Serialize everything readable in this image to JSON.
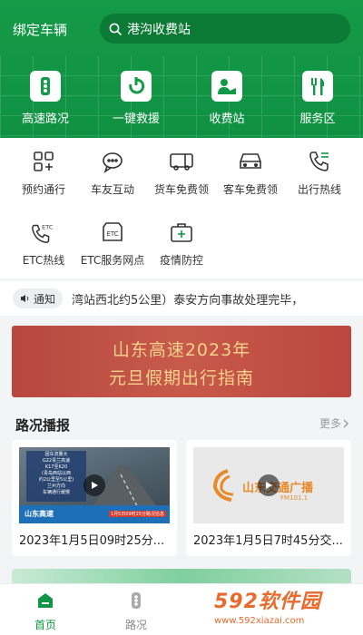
{
  "header": {
    "bind_car": "绑定车辆",
    "search_placeholder": "港沟收费站",
    "quick": [
      {
        "label": "高速路况",
        "icon": "traffic-light-icon"
      },
      {
        "label": "一键救援",
        "icon": "rescue-icon"
      },
      {
        "label": "收费站",
        "icon": "toll-station-icon"
      },
      {
        "label": "服务区",
        "icon": "service-area-icon"
      }
    ]
  },
  "services": [
    {
      "label": "预约通行",
      "icon": "reservation-grid-icon"
    },
    {
      "label": "车友互动",
      "icon": "chat-bubble-icon"
    },
    {
      "label": "货车免费领",
      "icon": "truck-icon"
    },
    {
      "label": "客车免费领",
      "icon": "car-icon"
    },
    {
      "label": "出行热线",
      "icon": "phone-icon"
    },
    {
      "label": "ETC热线",
      "icon": "etc-phone-icon"
    },
    {
      "label": "ETC服务网点",
      "icon": "etc-outlet-icon"
    },
    {
      "label": "疫情防控",
      "icon": "medical-kit-icon"
    }
  ],
  "notice": {
    "tag": "通知",
    "text": "湾站西北约5公里）泰安方向事故处理完毕，"
  },
  "banner": {
    "line1": "山东高速2023年",
    "line2": "元旦假期出行指南"
  },
  "road": {
    "title": "路况播报",
    "more": "更多",
    "cards": [
      {
        "caption": "2023年1月5日09时25分...",
        "thumb_lines": [
          "因车流量大",
          "G22青兰高速",
          "K17至K20",
          "(青岛西站以西",
          "约2公里至5公里)",
          "兰州方向",
          "车辆通行缓慢"
        ],
        "thumb_brand": "山东高速",
        "thumb_footer": "1月5日09时25分路况信息"
      },
      {
        "caption": "2023年1月5日7时45分交...",
        "thumb_brand": "山东交通广播",
        "thumb_sub": "FM101.1"
      }
    ]
  },
  "tabbar": {
    "tabs": [
      {
        "label": "首页",
        "active": true
      },
      {
        "label": "路况",
        "active": false
      }
    ]
  },
  "watermark": {
    "big": "592软件园",
    "small": "www.592xiazai.com"
  },
  "colors": {
    "primary": "#119546",
    "accent_orange": "#e86a2c"
  }
}
